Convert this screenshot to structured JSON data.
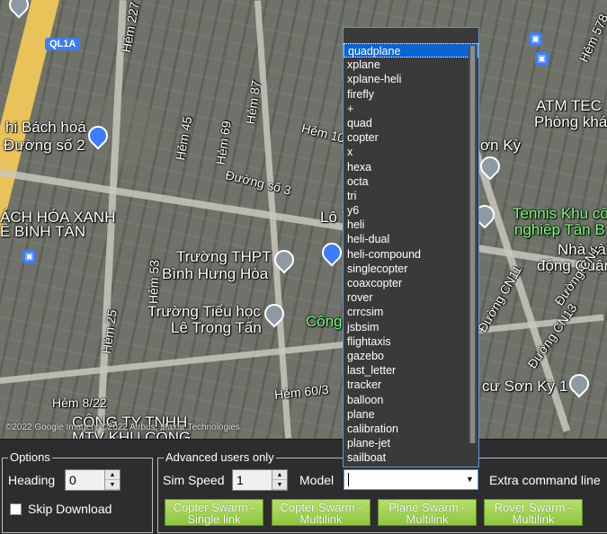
{
  "map": {
    "labels": [
      "QL1A",
      "Hẻm 227",
      "Hẻm 45",
      "Hẻm 69",
      "Hẻm 87",
      "Hẻm 10",
      "hi Bách hoá",
      "Đường số 2",
      "Đường số 3",
      "ÁCH HÓA XANH",
      "Ê BÌNH TÂN",
      "Trường THPT",
      "Bình Hưng Hòa",
      "Trường Tiểu học",
      "Lê Trọng Tấn",
      "Công",
      "Hẻm 53",
      "Hẻm 25",
      "Hẻm 8/22",
      "Hẻm 60/3",
      "CÔNG TY TNHH",
      "MTV KHU CÔNG",
      "Lô T",
      "ATM TEC",
      "Phòng khá",
      "ơn Kỳ",
      "Tennis Khu cô",
      "nghiệp Tân B",
      "Nhà và",
      "động Quận",
      "Đường CN11",
      "Đường CN13",
      "Đường CN1",
      "cư Sơn Kỳ 1",
      "Hẻm 578"
    ],
    "copyright": "©2022 Google Imagery ©2022 Airbus, Maxar Technologies"
  },
  "options": {
    "title": "Options",
    "heading_label": "Heading",
    "heading_value": "0",
    "skip_download_label": "Skip Download",
    "skip_download_checked": false
  },
  "advanced": {
    "title": "Advanced users only",
    "sim_speed_label": "Sim Speed",
    "sim_speed_value": "1",
    "model_label": "Model",
    "model_value": "",
    "extra_label": "Extra command line"
  },
  "buttons": {
    "copter_single": [
      "Copter Swarm -",
      "Single link"
    ],
    "copter_multi": [
      "Copter Swarm -",
      "Multilink"
    ],
    "plane_multi": [
      "Plane Swarm -",
      "Multilink"
    ],
    "rover_multi": [
      "Rover Swarm -",
      "Multilink"
    ]
  },
  "model_options": [
    "quadplane",
    "xplane",
    "xplane-heli",
    "firefly",
    "+",
    "quad",
    "copter",
    "x",
    "hexa",
    "octa",
    "tri",
    "y6",
    "heli",
    "heli-dual",
    "heli-compound",
    "singlecopter",
    "coaxcopter",
    "rover",
    "crrcsim",
    "jsbsim",
    "flightaxis",
    "gazebo",
    "last_letter",
    "tracker",
    "balloon",
    "plane",
    "calibration",
    "plane-jet",
    "sailboat"
  ],
  "model_selected_index": 0,
  "colors": {
    "accent": "#0a64d2",
    "button_green": "#8cc63f",
    "road_major": "#e9c35a",
    "panel_bg": "#2d2d30"
  }
}
